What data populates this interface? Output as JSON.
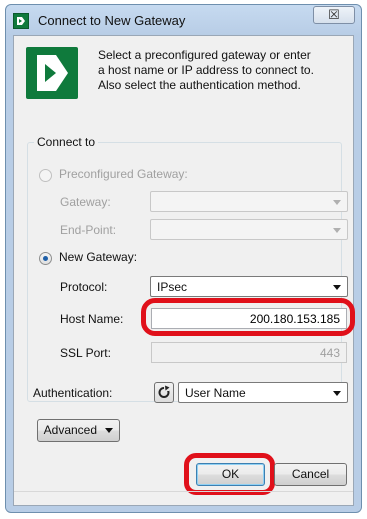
{
  "window": {
    "title": "Connect to New Gateway",
    "close_glyph": "☒"
  },
  "intro": {
    "line1": "Select a preconfigured gateway or enter",
    "line2": "a host name or IP address to connect to.",
    "line3": "Also select the authentication method."
  },
  "connect_to": {
    "group_title": "Connect to",
    "preconfigured": {
      "label": "Preconfigured Gateway:",
      "selected": false,
      "enabled": false
    },
    "gateway": {
      "label": "Gateway:",
      "value": ""
    },
    "endpoint": {
      "label": "End-Point:",
      "value": ""
    },
    "new_gateway": {
      "label": "New Gateway:",
      "selected": true
    },
    "protocol": {
      "label": "Protocol:",
      "value": "IPsec"
    },
    "host_name": {
      "label": "Host Name:",
      "value": "200.180.153.185"
    },
    "ssl_port": {
      "label": "SSL Port:",
      "value": "443"
    }
  },
  "authentication": {
    "label": "Authentication:",
    "value": "User Name",
    "refresh_icon": "refresh-icon"
  },
  "advanced": {
    "label": "Advanced"
  },
  "buttons": {
    "ok": "OK",
    "cancel": "Cancel"
  },
  "colors": {
    "brand_green": "#0f7a3c",
    "highlight_red": "#e0101a"
  }
}
